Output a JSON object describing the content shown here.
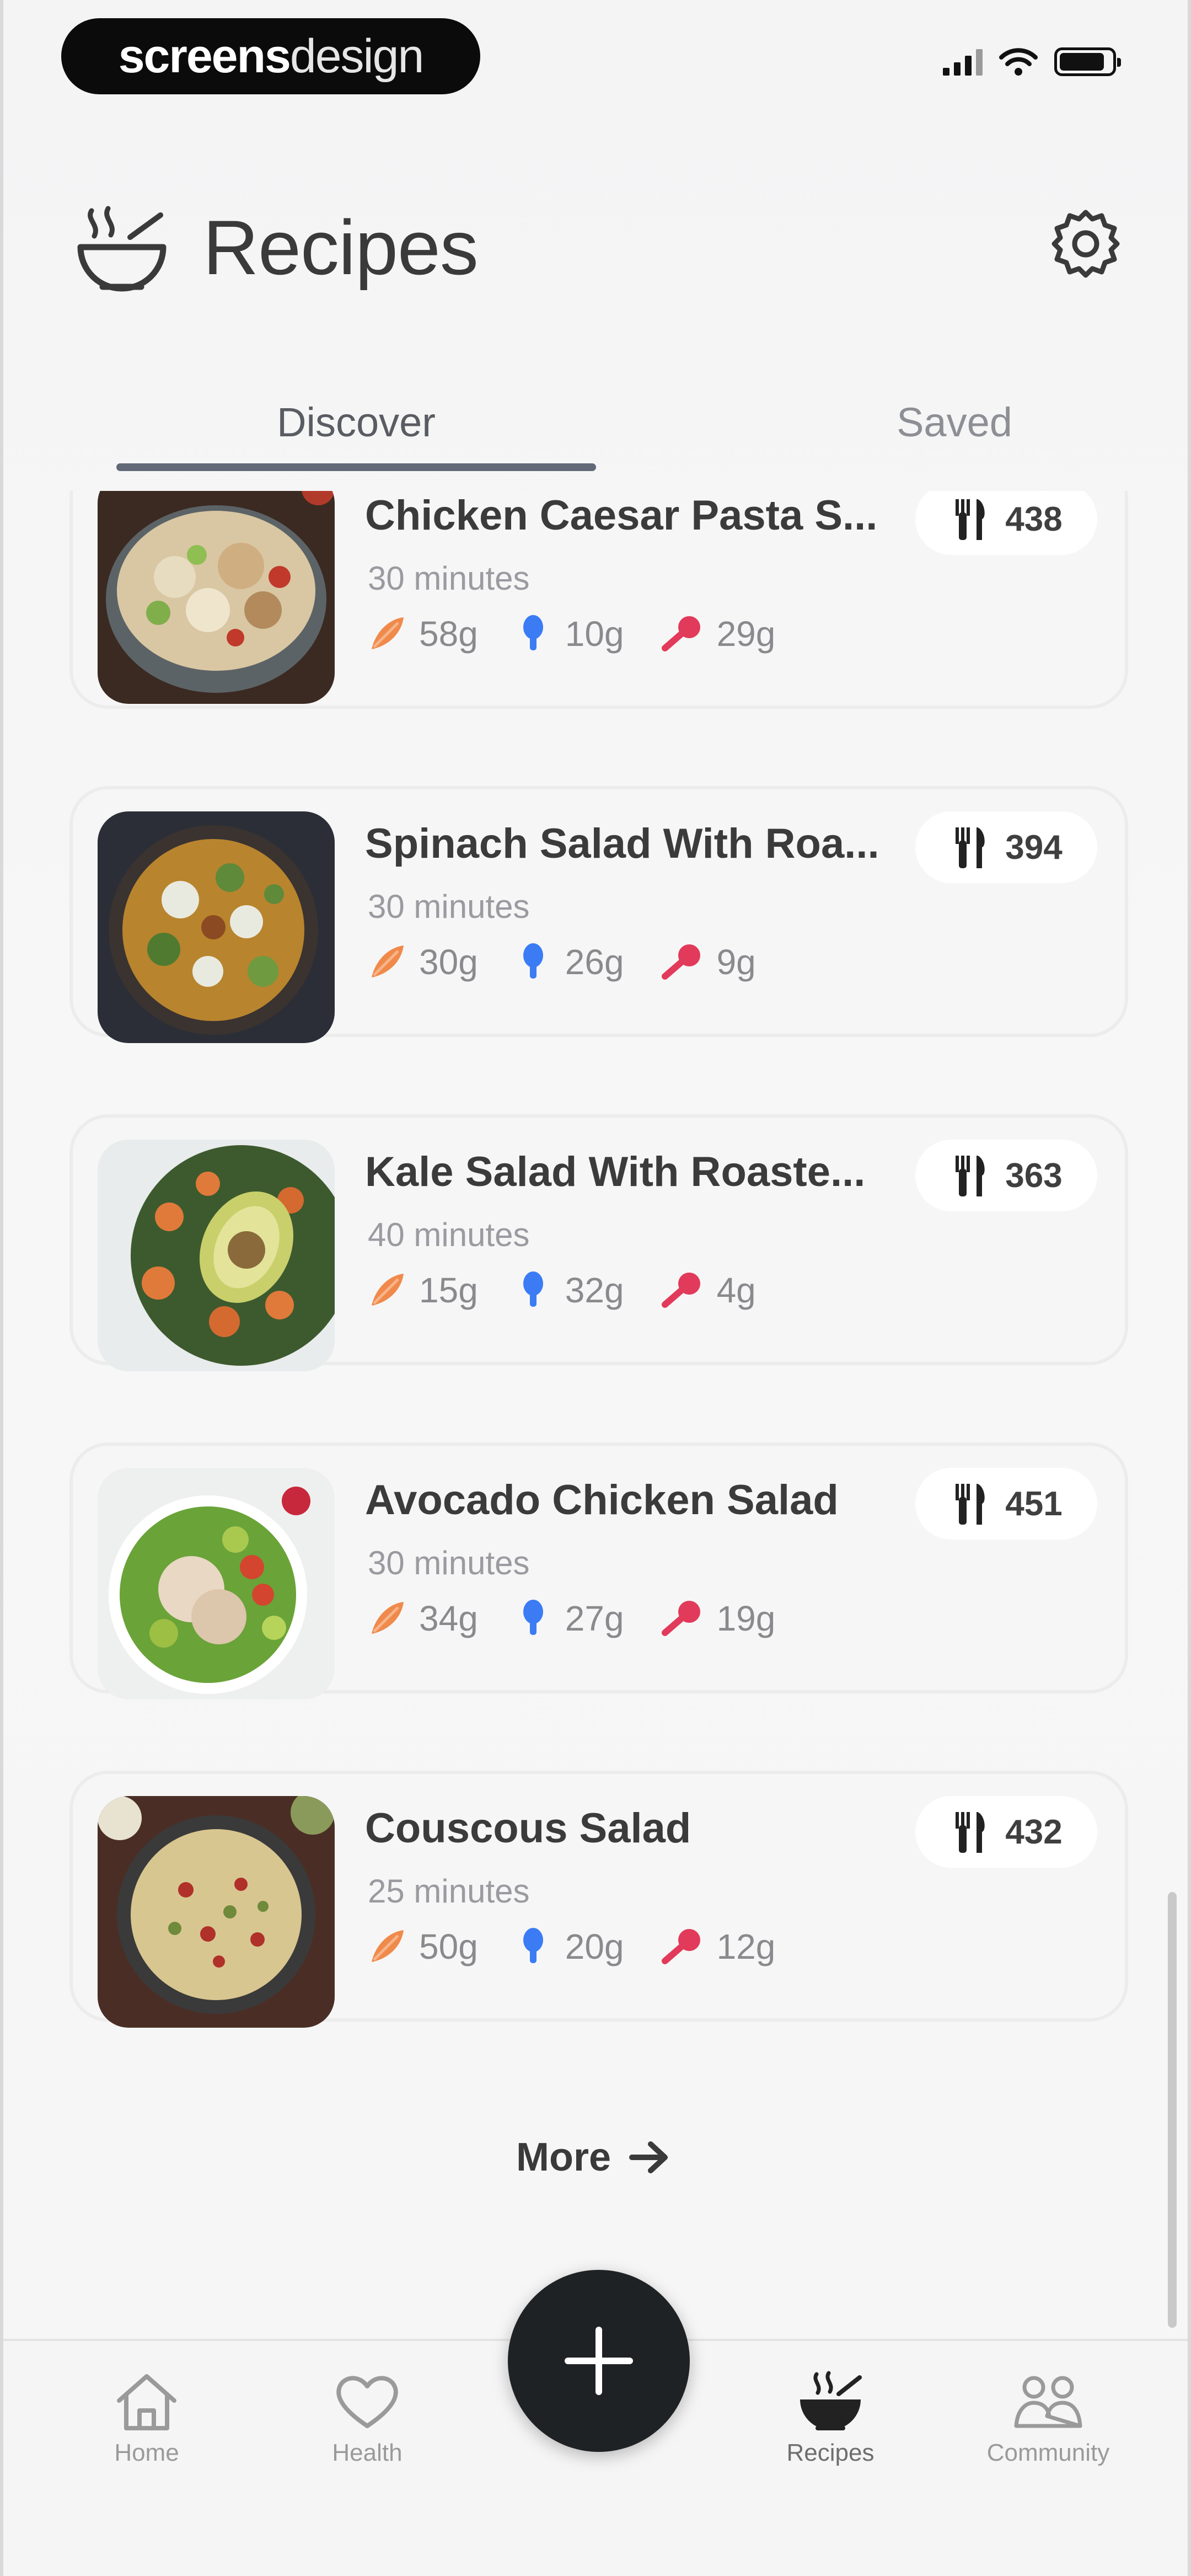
{
  "status_bar": {
    "brand_bold": "screens",
    "brand_light": "design"
  },
  "header": {
    "title": "Recipes"
  },
  "tabs": [
    {
      "label": "Discover",
      "active": true
    },
    {
      "label": "Saved",
      "active": false
    }
  ],
  "recipes": [
    {
      "title": "Chicken Caesar Pasta S...",
      "time": "30 minutes",
      "kcal": "438",
      "carbs": "58g",
      "protein": "10g",
      "fat": "29g",
      "image": "pasta-salad"
    },
    {
      "title": "Spinach Salad With Roa...",
      "time": "30 minutes",
      "kcal": "394",
      "carbs": "30g",
      "protein": "26g",
      "fat": "9g",
      "image": "spinach-bowl"
    },
    {
      "title": "Kale Salad With Roaste...",
      "time": "40 minutes",
      "kcal": "363",
      "carbs": "15g",
      "protein": "32g",
      "fat": "4g",
      "image": "kale-avocado"
    },
    {
      "title": "Avocado Chicken Salad",
      "time": "30 minutes",
      "kcal": "451",
      "carbs": "34g",
      "protein": "27g",
      "fat": "19g",
      "image": "avocado-chicken"
    },
    {
      "title": "Couscous Salad",
      "time": "25 minutes",
      "kcal": "432",
      "carbs": "50g",
      "protein": "20g",
      "fat": "12g",
      "image": "couscous"
    }
  ],
  "more": {
    "label": "More"
  },
  "nav": {
    "items": [
      {
        "label": "Home",
        "icon": "home-icon"
      },
      {
        "label": "Health",
        "icon": "heart-icon"
      },
      {
        "label": "Recipes",
        "icon": "bowl-icon",
        "active": true
      },
      {
        "label": "Community",
        "icon": "people-icon"
      }
    ]
  },
  "colors": {
    "carbs": "#f08a4b",
    "protein": "#3b7cf5",
    "fat": "#e23a5a",
    "accent": "#616977",
    "fab": "#1f2224"
  }
}
